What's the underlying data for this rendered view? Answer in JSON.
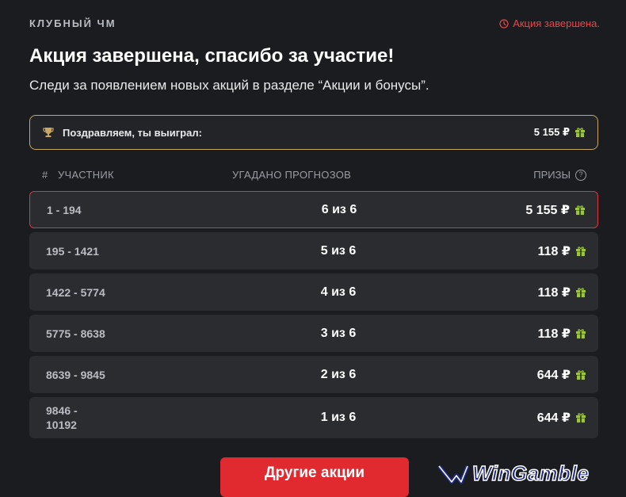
{
  "header": {
    "brand": "КЛУБНЫЙ ЧМ",
    "status": "Акция завершена."
  },
  "title": "Акция завершена, спасибо за участие!",
  "subtitle": "Следи за появлением новых акций в разделе “Акции и бонусы”.",
  "winner": {
    "label": "Поздравляем, ты выиграл:",
    "amount": "5 155 ₽"
  },
  "table": {
    "col_num": "#",
    "col_participant": "УЧАСТНИК",
    "col_guessed": "УГАДАНО ПРОГНОЗОВ",
    "col_prizes": "ПРИЗЫ",
    "rows": [
      {
        "range": "1 - 194",
        "guessed": "6 из 6",
        "prize": "5 155 ₽"
      },
      {
        "range": "195 - 1421",
        "guessed": "5 из 6",
        "prize": "118 ₽"
      },
      {
        "range": "1422 - 5774",
        "guessed": "4 из 6",
        "prize": "118 ₽"
      },
      {
        "range": "5775 - 8638",
        "guessed": "3 из 6",
        "prize": "118 ₽"
      },
      {
        "range": "8639 - 9845",
        "guessed": "2 из 6",
        "prize": "644 ₽"
      },
      {
        "range": "9846 - 10192",
        "guessed": "1 из 6",
        "prize": "644 ₽"
      }
    ]
  },
  "button": {
    "label": "Другие акции"
  },
  "watermark": {
    "text": "WinGamble"
  },
  "colors": {
    "background": "#1b1c1f",
    "row": "#2b2c30",
    "accent_red": "#e02a2f",
    "gold_border": "#c8a860",
    "gift_green": "#9bc63b"
  },
  "icons": {
    "status": "clock-icon",
    "winner": "trophy-icon",
    "prize": "gift-icon",
    "help": "question-icon"
  }
}
